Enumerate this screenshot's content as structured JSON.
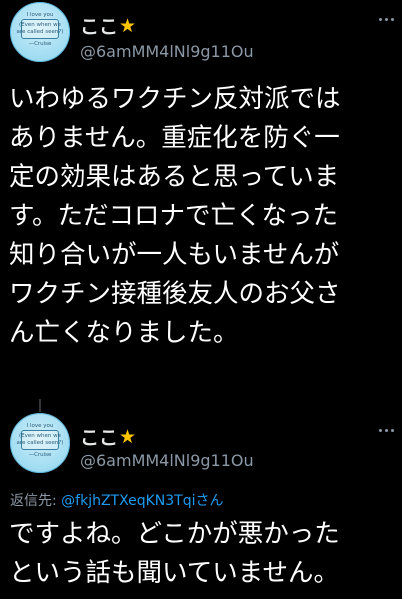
{
  "tweets": [
    {
      "display_name": "ここ",
      "handle": "@6amMM4lNl9g11Ou",
      "avatar_text": [
        "I love you",
        "(Even when we",
        "are called seen?)",
        "—Cruise"
      ],
      "lines": [
        "いわゆるワクチン反対派では",
        "ありません。重症化を防ぐ一",
        "定の効果はあると思っていま",
        "す。ただコロナで亡くなった",
        "知り合いが一人もいませんが",
        "ワクチン接種後友人のお父さ",
        "ん亡くなりました。"
      ]
    },
    {
      "display_name": "ここ",
      "handle": "@6amMM4lNl9g11Ou",
      "avatar_text": [
        "I love you",
        "(Even when we",
        "are called seen?)",
        "—Cruise"
      ],
      "reply_prefix": "返信先: ",
      "reply_mention": "@fkjhZTXeqKN3Tqiさん",
      "lines": [
        "ですよね。どこかが悪かった",
        "という話も聞いていません。"
      ]
    }
  ],
  "colors": {
    "background": "#000000",
    "text": "#ffffff",
    "secondary": "#8b98a5",
    "accent_link": "#1d9bf0",
    "star": "#ffc400"
  },
  "icons": [
    "star-icon",
    "more-icon"
  ]
}
